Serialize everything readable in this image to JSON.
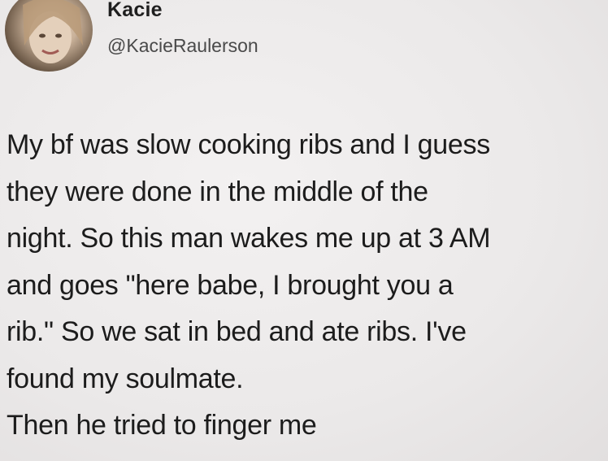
{
  "tweet": {
    "display_name": "Kacie",
    "handle": "@KacieRaulerson",
    "avatar_icon": "profile-photo",
    "lines": [
      "My bf was slow cooking ribs and I guess",
      "they were done in the middle of the",
      "night. So this man wakes me up at 3 AM",
      "and goes \"here babe, I brought you a",
      "rib.\" So we sat in bed and ate ribs. I've",
      "found my soulmate.",
      "Then he tried to finger me"
    ]
  }
}
